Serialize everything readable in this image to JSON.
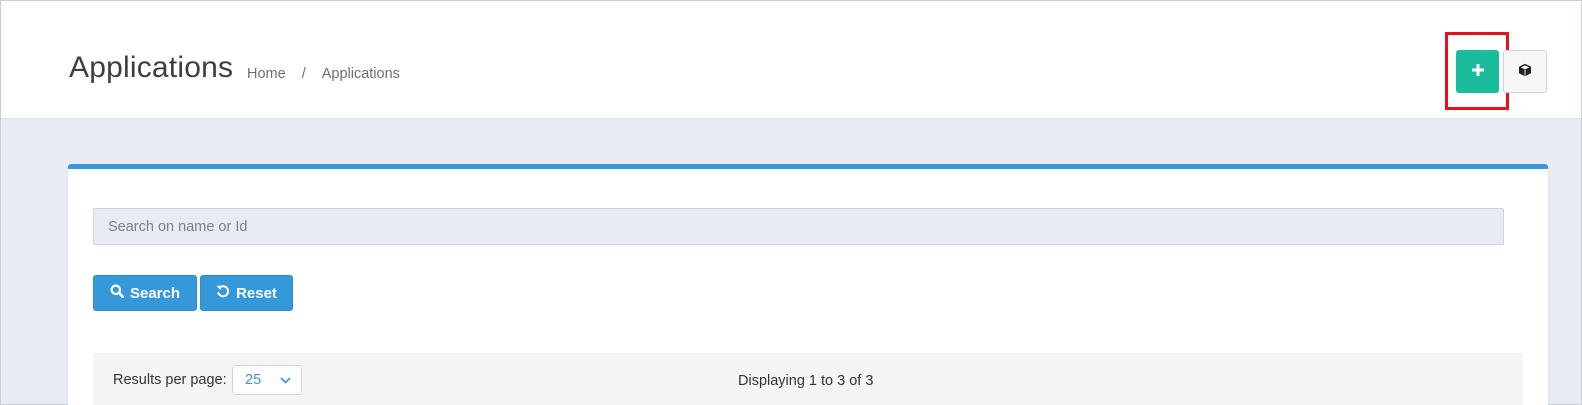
{
  "header": {
    "title": "Applications",
    "breadcrumb": {
      "home": "Home",
      "separator": "/",
      "current": "Applications"
    },
    "add_button_icon": "plus-icon",
    "package_button_icon": "cube-icon"
  },
  "search": {
    "placeholder": "Search on name or Id",
    "value": "",
    "search_label": "Search",
    "search_icon": "search-icon",
    "reset_label": "Reset",
    "reset_icon": "undo-icon"
  },
  "results": {
    "per_page_label": "Results per page:",
    "per_page_value": "25",
    "display_text": "Displaying 1 to 3 of 3"
  },
  "colors": {
    "accent_green": "#1abc9c",
    "accent_blue": "#3498db",
    "highlight_red": "#e8111b"
  }
}
